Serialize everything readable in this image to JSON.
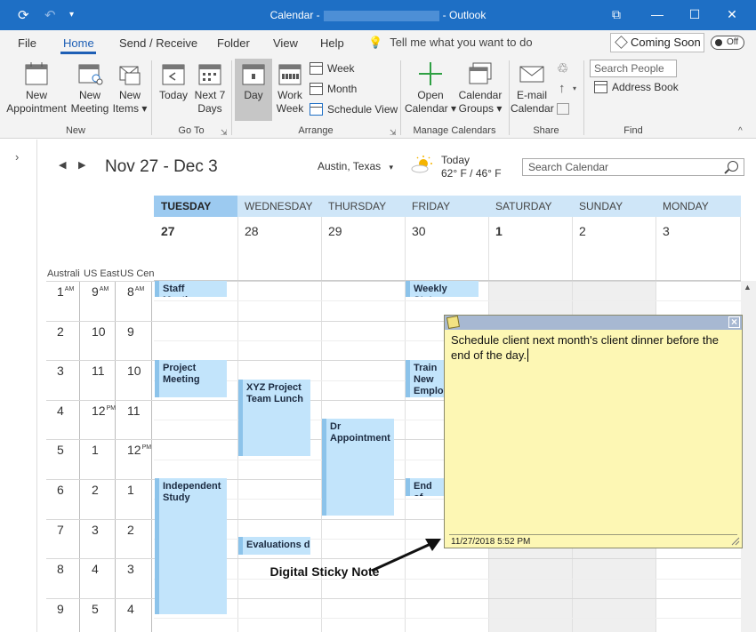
{
  "window": {
    "title_prefix": "Calendar -",
    "title_suffix": "- Outlook",
    "minimize": "—",
    "maximize": "☐",
    "close": "✕",
    "restore_icon": "⧉"
  },
  "menu": {
    "file": "File",
    "home": "Home",
    "send_receive": "Send / Receive",
    "folder": "Folder",
    "view": "View",
    "help": "Help",
    "tell_me": "Tell me what you want to do",
    "coming_soon": "Coming Soon",
    "toggle": "Off"
  },
  "ribbon": {
    "new_appointment": [
      "New",
      "Appointment"
    ],
    "new_meeting": [
      "New",
      "Meeting"
    ],
    "new_items": [
      "New",
      "Items ▾"
    ],
    "group_new": "New",
    "today": "Today",
    "next7": [
      "Next 7",
      "Days"
    ],
    "group_goto": "Go To",
    "day": "Day",
    "work_week": [
      "Work",
      "Week"
    ],
    "week": "Week",
    "month": "Month",
    "schedule_view": "Schedule View",
    "group_arrange": "Arrange",
    "open_calendar": [
      "Open",
      "Calendar ▾"
    ],
    "calendar_groups": [
      "Calendar",
      "Groups ▾"
    ],
    "group_manage": "Manage Calendars",
    "email_calendar": [
      "E-mail",
      "Calendar"
    ],
    "group_share": "Share",
    "search_people": "Search People",
    "address_book": "Address Book",
    "group_find": "Find"
  },
  "calendar": {
    "date_range": "Nov 27 - Dec 3",
    "location": "Austin, Texas",
    "today_label": "Today",
    "temperature": "62° F / 46° F",
    "search_placeholder": "Search Calendar",
    "days": [
      {
        "name": "TUESDAY",
        "num": "27"
      },
      {
        "name": "WEDNESDAY",
        "num": "28"
      },
      {
        "name": "THURSDAY",
        "num": "29"
      },
      {
        "name": "FRIDAY",
        "num": "30"
      },
      {
        "name": "SATURDAY",
        "num": "1"
      },
      {
        "name": "SUNDAY",
        "num": "2"
      },
      {
        "name": "MONDAY",
        "num": "3"
      }
    ],
    "timezones": [
      "Australi",
      "US East",
      "US Cen"
    ],
    "time_rows": [
      [
        "1",
        "AM",
        "9",
        "AM",
        "8",
        "AM"
      ],
      [
        "2",
        "",
        "10",
        "",
        "9",
        ""
      ],
      [
        "3",
        "",
        "11",
        "",
        "10",
        ""
      ],
      [
        "4",
        "",
        "12",
        "PM",
        "11",
        ""
      ],
      [
        "5",
        "",
        "1",
        "",
        "12",
        "PM"
      ],
      [
        "6",
        "",
        "2",
        "",
        "1",
        ""
      ],
      [
        "7",
        "",
        "3",
        "",
        "2",
        ""
      ],
      [
        "8",
        "",
        "4",
        "",
        "3",
        ""
      ],
      [
        "9",
        "",
        "5",
        "",
        "4",
        ""
      ]
    ],
    "events": {
      "staff_meeting": "Staff Meeting",
      "weekly_status": "Weekly Status",
      "project_meeting": "Project Meeting",
      "xyz_lunch": "XYZ Project Team Lunch",
      "train": "Train New Employ",
      "dr_appointment": "Dr Appointment",
      "independent_study": "Independent Study",
      "end_of": "End of",
      "evaluations": "Evaluations du"
    }
  },
  "sticky_note": {
    "text": "Schedule client next month's client dinner before the end of the day.",
    "timestamp": "11/27/2018 5:52 PM"
  },
  "annotation": {
    "label": "Digital Sticky Note"
  }
}
